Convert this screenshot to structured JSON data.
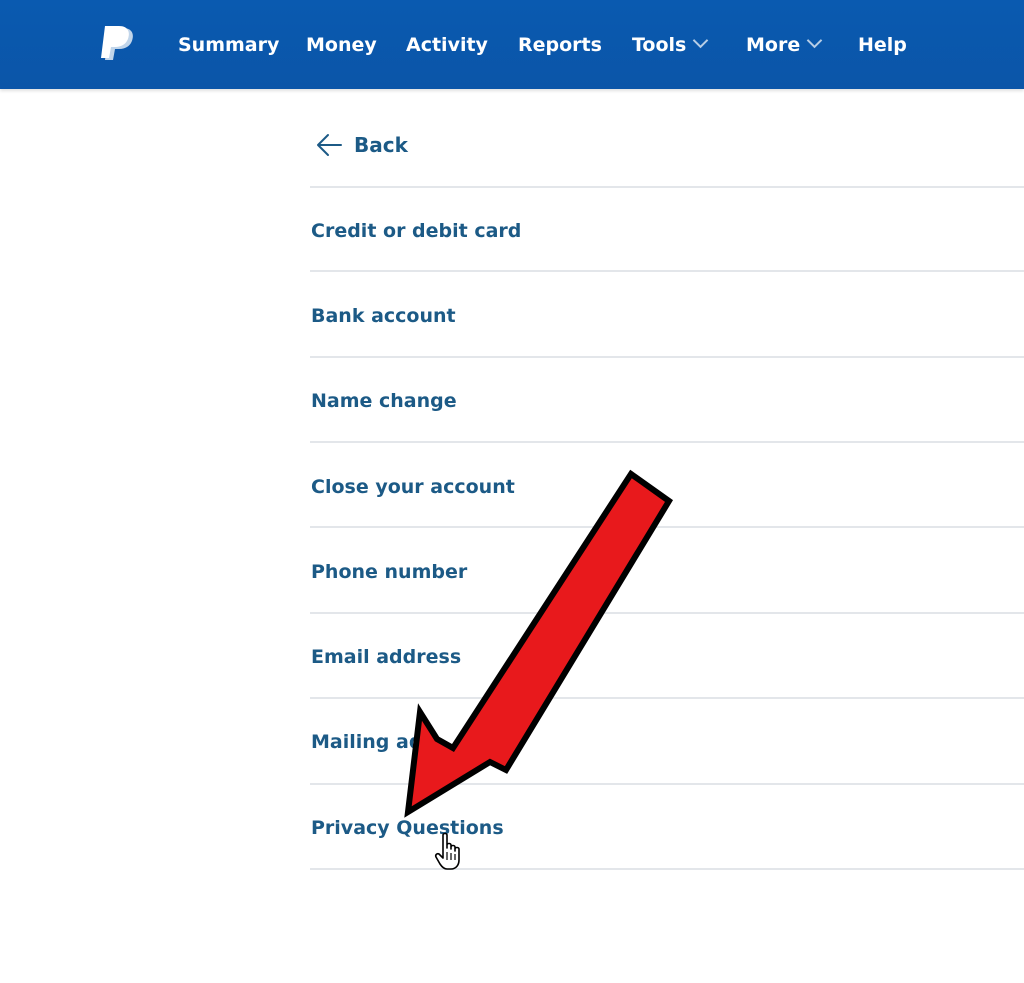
{
  "header": {
    "logo_icon": "paypal-logo-icon",
    "nav": [
      {
        "label": "Summary",
        "dropdown": false
      },
      {
        "label": "Money",
        "dropdown": false
      },
      {
        "label": "Activity",
        "dropdown": false
      },
      {
        "label": "Reports",
        "dropdown": false
      },
      {
        "label": "Tools",
        "dropdown": true
      },
      {
        "label": "More",
        "dropdown": true
      },
      {
        "label": "Help",
        "dropdown": false
      }
    ]
  },
  "main": {
    "back_label": "Back",
    "items": [
      {
        "label": "Credit or debit card"
      },
      {
        "label": "Bank account"
      },
      {
        "label": "Name change"
      },
      {
        "label": "Close your account"
      },
      {
        "label": "Phone number"
      },
      {
        "label": "Email address"
      },
      {
        "label": "Mailing ad"
      },
      {
        "label": "Privacy Questions"
      }
    ]
  },
  "colors": {
    "header_bg": "#0b55a8",
    "link_text": "#1c5a86",
    "divider": "#e3e6ea",
    "annotation_arrow": "#e8191c"
  },
  "overlay": {
    "arrow_icon": "red-arrow-annotation",
    "cursor_icon": "hand-pointer-cursor-icon"
  }
}
